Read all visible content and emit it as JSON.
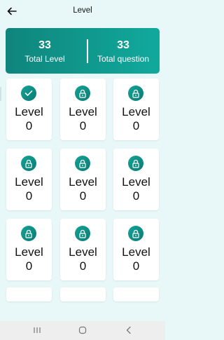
{
  "header": {
    "title": "Level",
    "back_icon": "arrow-left-icon"
  },
  "summary": {
    "total_level_value": "33",
    "total_level_label": "Total Level",
    "total_question_value": "33",
    "total_question_label": "Total question"
  },
  "levels": [
    {
      "label": "Level",
      "value": "0",
      "status": "completed",
      "icon": "check-icon"
    },
    {
      "label": "Level",
      "value": "0",
      "status": "locked",
      "icon": "lock-icon"
    },
    {
      "label": "Level",
      "value": "0",
      "status": "locked",
      "icon": "lock-icon"
    },
    {
      "label": "Level",
      "value": "0",
      "status": "locked",
      "icon": "lock-icon"
    },
    {
      "label": "Level",
      "value": "0",
      "status": "locked",
      "icon": "lock-icon"
    },
    {
      "label": "Level",
      "value": "0",
      "status": "locked",
      "icon": "lock-icon"
    },
    {
      "label": "Level",
      "value": "0",
      "status": "locked",
      "icon": "lock-icon"
    },
    {
      "label": "Level",
      "value": "0",
      "status": "locked",
      "icon": "lock-icon"
    },
    {
      "label": "Level",
      "value": "0",
      "status": "locked",
      "icon": "lock-icon"
    }
  ],
  "colors": {
    "accent_dark": "#0f857c",
    "accent_light": "#11a99c",
    "background": "#e8f8f8",
    "card": "#ffffff"
  },
  "system_nav": {
    "recents_icon": "recents-icon",
    "home_icon": "home-icon",
    "back_icon": "back-chevron-icon"
  }
}
